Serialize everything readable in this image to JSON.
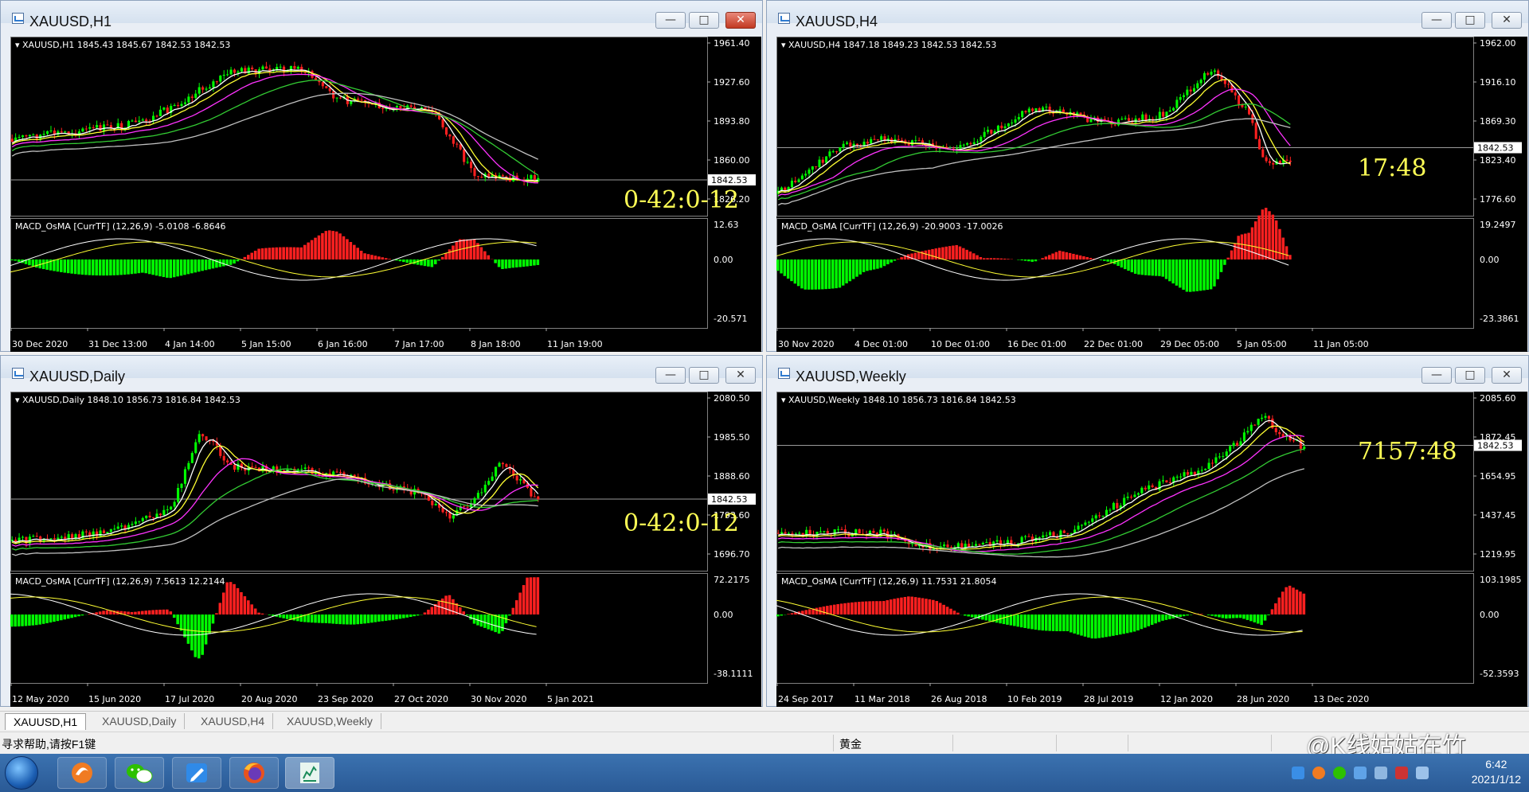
{
  "windows": [
    {
      "title": "XAUUSD,H1",
      "info": "XAUUSD,H1  1845.43 1845.67 1842.53 1842.53",
      "macd_label": "MACD_OsMA [CurrTF] (12,26,9) -5.0108 -6.8646",
      "price_scale": [
        "1961.40",
        "1927.60",
        "1893.80",
        "1860.00",
        "1826.20"
      ],
      "current_price": "1842.53",
      "macd_scale": [
        "12.63",
        "0.00",
        "-20.571"
      ],
      "time_labels": [
        "30 Dec 2020",
        "31 Dec 13:00",
        "4 Jan 14:00",
        "5 Jan 15:00",
        "6 Jan 16:00",
        "7 Jan 17:00",
        "8 Jan 18:00",
        "11 Jan 19:00"
      ],
      "countdown": "0-42:0-12",
      "close_active": true
    },
    {
      "title": "XAUUSD,H4",
      "info": "XAUUSD,H4  1847.18 1849.23 1842.53 1842.53",
      "macd_label": "MACD_OsMA [CurrTF] (12,26,9) -20.9003 -17.0026",
      "price_scale": [
        "1962.00",
        "1916.10",
        "1869.30",
        "1823.40",
        "1776.60"
      ],
      "current_price": "1842.53",
      "macd_scale": [
        "19.2497",
        "0.00",
        "-23.3861"
      ],
      "time_labels": [
        "30 Nov 2020",
        "4 Dec 01:00",
        "10 Dec 01:00",
        "16 Dec 01:00",
        "22 Dec 01:00",
        "29 Dec 05:00",
        "5 Jan 05:00",
        "11 Jan 05:00"
      ],
      "countdown": "17:48",
      "close_active": false
    },
    {
      "title": "XAUUSD,Daily",
      "info": "XAUUSD,Daily  1848.10 1856.73 1816.84 1842.53",
      "macd_label": "MACD_OsMA [CurrTF] (12,26,9) 7.5613 12.2144",
      "price_scale": [
        "2080.50",
        "1985.50",
        "1888.60",
        "1793.60",
        "1696.70"
      ],
      "current_price": "1842.53",
      "macd_scale": [
        "72.2175",
        "0.00",
        "-38.1111"
      ],
      "time_labels": [
        "12 May 2020",
        "15 Jun 2020",
        "17 Jul 2020",
        "20 Aug 2020",
        "23 Sep 2020",
        "27 Oct 2020",
        "30 Nov 2020",
        "5 Jan 2021"
      ],
      "countdown": "0-42:0-12",
      "close_active": false
    },
    {
      "title": "XAUUSD,Weekly",
      "info": "XAUUSD,Weekly  1848.10 1856.73 1816.84 1842.53",
      "macd_label": "MACD_OsMA [CurrTF] (12,26,9) 11.7531 21.8054",
      "price_scale": [
        "2085.60",
        "1872.45",
        "1654.95",
        "1437.45",
        "1219.95"
      ],
      "current_price": "1842.53",
      "macd_scale": [
        "103.1985",
        "0.00",
        "-52.3593"
      ],
      "time_labels": [
        "24 Sep 2017",
        "11 Mar 2018",
        "26 Aug 2018",
        "10 Feb 2019",
        "28 Jul 2019",
        "12 Jan 2020",
        "28 Jun 2020",
        "13 Dec 2020"
      ],
      "countdown": "7157:48",
      "close_active": false
    }
  ],
  "tabs": [
    "XAUUSD,H1",
    "XAUUSD,Daily",
    "XAUUSD,H4",
    "XAUUSD,Weekly"
  ],
  "status": {
    "help": "寻求帮助,请按F1键",
    "profile": "黄金"
  },
  "watermark": "@K线姑姑在竹",
  "clock": {
    "time": "6:42",
    "date": "2021/1/12"
  },
  "colors": {
    "bull": "#00ff00",
    "bear": "#ff2020",
    "ma_fast": "#ffffff",
    "ma_yellow": "#ffff33",
    "ma_magenta": "#ff33ff",
    "ma_green": "#33cc33",
    "ma_gray": "#c0c0c0",
    "countdown": "#ffff55"
  }
}
